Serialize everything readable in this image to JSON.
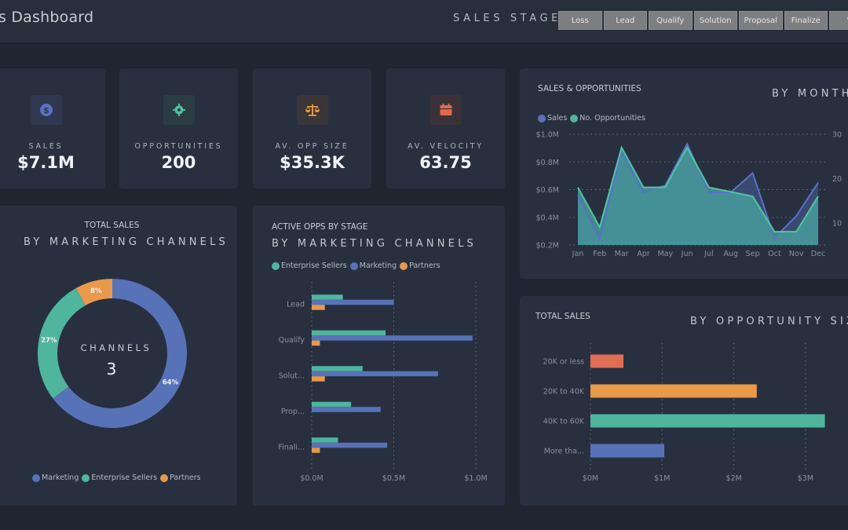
{
  "header": {
    "title": "s Dashboard",
    "stage_label": "SALES STAGE",
    "stage_buttons": [
      "Loss",
      "Lead",
      "Qualify",
      "Solution",
      "Proposal",
      "Finalize",
      "W"
    ]
  },
  "kpis": [
    {
      "label": "SALES",
      "value": "$7.1M",
      "icon": "dollar-icon",
      "color": "#5a72c0",
      "bg": "#2f3850"
    },
    {
      "label": "OPPORTUNITIES",
      "value": "200",
      "icon": "target-icon",
      "color": "#4fc0a0",
      "bg": "#2c3c45"
    },
    {
      "label": "AV. OPP SIZE",
      "value": "$35.3K",
      "icon": "scale-icon",
      "color": "#e39a47",
      "bg": "#3a3638"
    },
    {
      "label": "AV. VELOCITY",
      "value": "63.75",
      "icon": "calendar-icon",
      "color": "#e2694f",
      "bg": "#3b3137"
    }
  ],
  "colors": {
    "marketing": "#5872b8",
    "enterprise": "#4fb59d",
    "partners": "#e89a4a",
    "red": "#e06e55"
  },
  "chart_data": [
    {
      "id": "sales_opps_month",
      "type": "area",
      "title": "SALES & OPPORTUNITIES",
      "subtitle": "BY MONTH",
      "legend": [
        "Sales",
        "No. Opportunities"
      ],
      "x": [
        "Jan",
        "Feb",
        "Mar",
        "Apr",
        "May",
        "Jun",
        "Jul",
        "Aug",
        "Sep",
        "Oct",
        "Nov",
        "Dec"
      ],
      "series": [
        {
          "name": "Sales",
          "axis": "left",
          "values": [
            0.56,
            0.24,
            0.88,
            0.58,
            0.63,
            0.93,
            0.58,
            0.58,
            0.72,
            0.25,
            0.41,
            0.65
          ]
        },
        {
          "name": "No. Opportunities",
          "axis": "right",
          "values": [
            18,
            9,
            27,
            18,
            18,
            27,
            18,
            17,
            16,
            8,
            8,
            16
          ]
        }
      ],
      "left_axis": {
        "ticks": [
          "$0.2M",
          "$0.4M",
          "$0.6M",
          "$0.8M",
          "$1.0M"
        ],
        "range": [
          0.2,
          1.0
        ]
      },
      "right_axis": {
        "ticks": [
          "10",
          "20",
          "30"
        ],
        "range": [
          5,
          30
        ]
      },
      "grid": true,
      "legend_position": "top-left"
    },
    {
      "id": "sales_by_channel",
      "type": "pie",
      "title": "TOTAL SALES",
      "subtitle": "BY MARKETING CHANNELS",
      "center_label": "CHANNELS",
      "center_value": "3",
      "slices": [
        {
          "name": "Marketing",
          "value": 64,
          "label": "64%"
        },
        {
          "name": "Enterprise Sellers",
          "value": 27,
          "label": "27%"
        },
        {
          "name": "Partners",
          "value": 8,
          "label": "8%"
        }
      ],
      "legend": [
        "Marketing",
        "Enterprise Sellers",
        "Partners"
      ],
      "legend_position": "bottom"
    },
    {
      "id": "active_opps_stage",
      "type": "bar",
      "orientation": "horizontal",
      "title": "ACTIVE OPPS BY STAGE",
      "subtitle": "BY MARKETING CHANNELS",
      "legend": [
        "Enterprise Sellers",
        "Marketing",
        "Partners"
      ],
      "categories": [
        "Lead",
        "Qualify",
        "Solut...",
        "Prop...",
        "Finali..."
      ],
      "series": [
        {
          "name": "Enterprise Sellers",
          "values": [
            0.19,
            0.45,
            0.31,
            0.24,
            0.16
          ]
        },
        {
          "name": "Marketing",
          "values": [
            0.5,
            0.98,
            0.77,
            0.42,
            0.46
          ]
        },
        {
          "name": "Partners",
          "values": [
            0.08,
            0.05,
            0.08,
            0,
            0.05
          ]
        }
      ],
      "x_ticks": [
        "$0.0M",
        "$0.5M",
        "$1.0M"
      ],
      "xlim": [
        0,
        1.0
      ],
      "grid": true,
      "legend_position": "top-left"
    },
    {
      "id": "sales_by_opp_size",
      "type": "bar",
      "orientation": "horizontal",
      "title": "TOTAL SALES",
      "subtitle": "BY OPPORTUNITY SIZE",
      "categories": [
        "20K or less",
        "20K to 40K",
        "40K to 60K",
        "More tha..."
      ],
      "values": [
        0.46,
        2.32,
        3.27,
        1.03
      ],
      "x_ticks": [
        "$0M",
        "$1M",
        "$2M",
        "$3M"
      ],
      "xlim": [
        0,
        3
      ],
      "grid": true
    }
  ]
}
